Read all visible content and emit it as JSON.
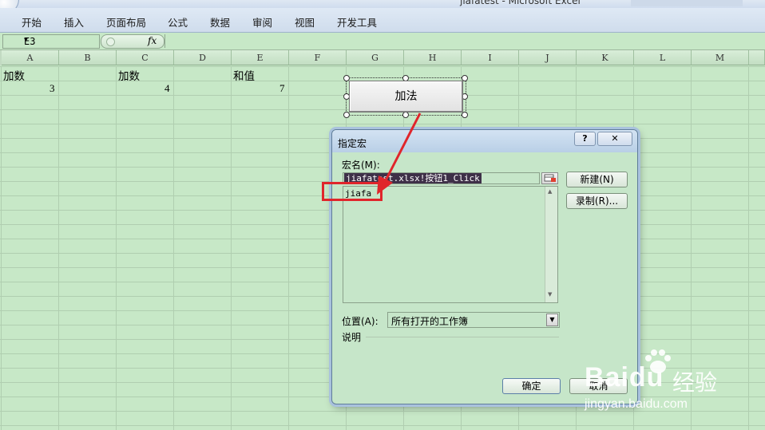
{
  "window": {
    "title": "jiafatest - Microsoft Excel"
  },
  "ribbon": {
    "tabs": [
      "开始",
      "插入",
      "页面布局",
      "公式",
      "数据",
      "审阅",
      "视图",
      "开发工具"
    ]
  },
  "formula_bar": {
    "name_box": "E3",
    "fx_label": "fx",
    "formula": ""
  },
  "columns": [
    "A",
    "B",
    "C",
    "D",
    "E",
    "F",
    "G",
    "H",
    "I",
    "J",
    "K",
    "L",
    "M"
  ],
  "cells": {
    "A1": "加数",
    "C1": "加数",
    "E1": "和值",
    "A2": "3",
    "C2": "4",
    "E2": "7"
  },
  "form_button": {
    "label": "加法"
  },
  "dialog": {
    "title": "指定宏",
    "help_glyph": "?",
    "close_glyph": "✕",
    "macro_name_label": "宏名(M):",
    "macro_name_value": "jiafatest.xlsx!按钮1_Click",
    "macro_list": [
      "jiafa"
    ],
    "new_button": "新建(N)",
    "record_button": "录制(R)...",
    "location_label": "位置(A):",
    "location_value": "所有打开的工作簿",
    "description_label": "说明",
    "ok_button": "确定",
    "cancel_button": "取消"
  },
  "annotation": {
    "color": "#e0252b"
  },
  "watermark": {
    "brand": "Baidu",
    "product": "经验",
    "url": "jingyan.baidu.com"
  }
}
